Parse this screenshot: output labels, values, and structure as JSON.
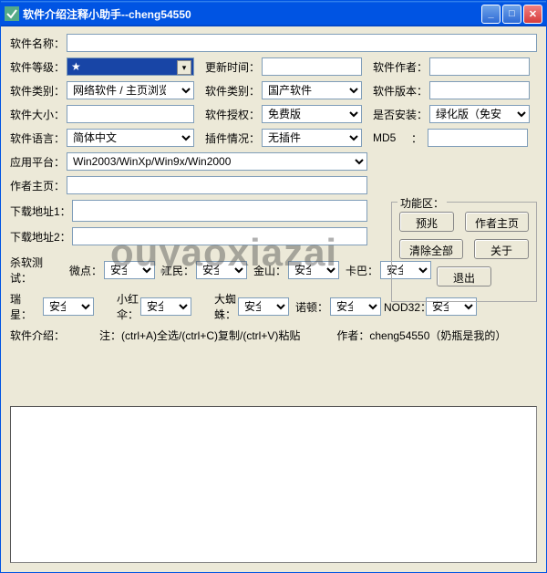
{
  "window": {
    "title": "软件介绍注释小助手--cheng54550"
  },
  "labels": {
    "name": "软件名称：",
    "rating": "软件等级：",
    "updateTime": "更新时间：",
    "author": "软件作者：",
    "category1": "软件类别：",
    "category2": "软件类别：",
    "version": "软件版本：",
    "size": "软件大小：",
    "license": "软件授权：",
    "install": "是否安装：",
    "language": "软件语言：",
    "plugin": "插件情况：",
    "md5": "MD5",
    "platform": "应用平台：",
    "authorHome": "作者主页：",
    "dl1": "下载地址1：",
    "dl2": "下载地址2：",
    "avtest": "杀软测试：",
    "intro": "软件介绍：",
    "funcArea": "功能区："
  },
  "values": {
    "name": "",
    "rating": "★",
    "updateTime": "",
    "author": "",
    "category1": "网络软件 / 主页浏览",
    "category2": "国产软件",
    "version": "",
    "size": "",
    "license": "免费版",
    "install": "绿化版（免安装）",
    "language": "简体中文",
    "plugin": "无插件",
    "md5": "",
    "platform": "Win2003/WinXp/Win9x/Win2000",
    "authorHome": "",
    "dl1": "",
    "dl2": ""
  },
  "buttons": {
    "preview": "预兆",
    "authorPage": "作者主页",
    "clearAll": "清除全部",
    "about": "关于",
    "exit": "退出"
  },
  "av": {
    "row1": [
      {
        "name": "微点：",
        "val": "安全"
      },
      {
        "name": "江民：",
        "val": "安全"
      },
      {
        "name": "金山：",
        "val": "安全"
      },
      {
        "name": "卡巴：",
        "val": "安全"
      }
    ],
    "row2": [
      {
        "name": "瑞星：",
        "val": "安全"
      },
      {
        "name": "小红伞：",
        "val": "安全"
      },
      {
        "name": "大蜘蛛：",
        "val": "安全"
      },
      {
        "name": "诺顿：",
        "val": "安全"
      },
      {
        "name": "NOD32：",
        "val": "安全"
      }
    ]
  },
  "hint": "注：(ctrl+A)全选/(ctrl+C)复制/(ctrl+V)粘贴",
  "credit": "作者：cheng54550（奶瓶是我的）",
  "colon": "：",
  "watermark": "ouyaoxiazai"
}
